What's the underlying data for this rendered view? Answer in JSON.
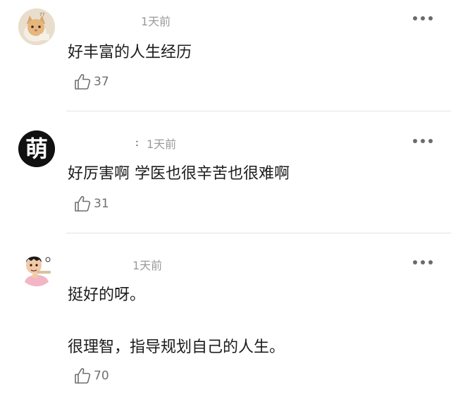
{
  "comments": [
    {
      "time": "1天前",
      "text": "好丰富的人生经历",
      "likes": "37",
      "avatar": "cat-avatar"
    },
    {
      "time": "1天前",
      "text": "好厉害啊 学医也很辛苦也很难啊",
      "likes": "31",
      "avatar": "meng-character-avatar",
      "avatar_text": "萌"
    },
    {
      "time": "1天前",
      "text_lines": [
        "挺好的呀。",
        "很理智，指导规划自己的人生。"
      ],
      "likes": "70",
      "avatar": "cartoon-man-avatar"
    }
  ],
  "icons": {
    "like": "thumbs-up-outline-icon",
    "more": "more-dots-icon"
  },
  "colors": {
    "text": "#1c1c1c",
    "muted": "#9a9a9a",
    "divider": "#e3e3e3"
  }
}
